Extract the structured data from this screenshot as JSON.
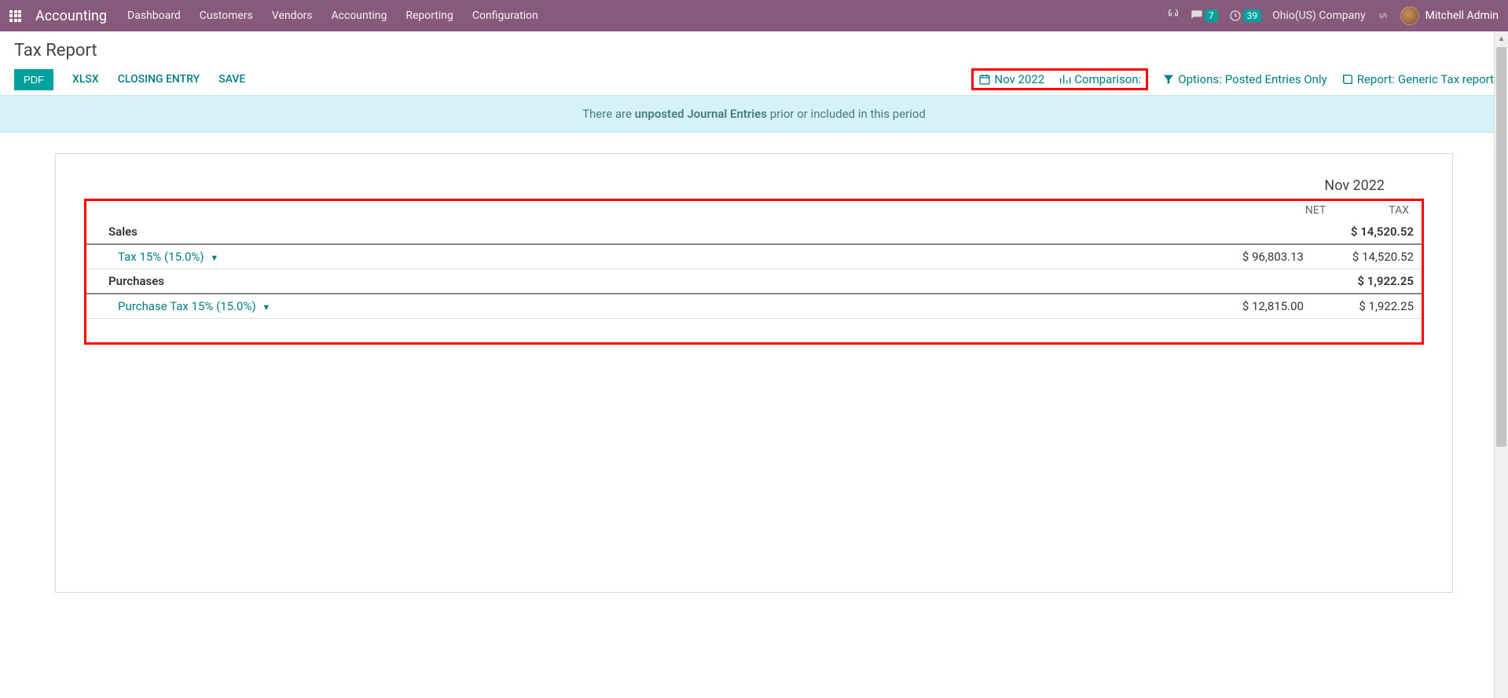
{
  "navbar": {
    "brand": "Accounting",
    "menu": [
      "Dashboard",
      "Customers",
      "Vendors",
      "Accounting",
      "Reporting",
      "Configuration"
    ],
    "messages_badge": "7",
    "activities_badge": "39",
    "company": "Ohio(US) Company",
    "user": "Mitchell Admin"
  },
  "page": {
    "title": "Tax Report",
    "actions": {
      "pdf": "PDF",
      "xlsx": "XLSX",
      "closing_entry": "CLOSING ENTRY",
      "save": "SAVE"
    },
    "filters": {
      "date_label": "Nov 2022",
      "comparison_label": "Comparison:",
      "options_prefix": "Options:",
      "options_value": "Posted Entries Only",
      "report_prefix": "Report: ",
      "report_value": "Generic Tax report"
    }
  },
  "banner": {
    "prefix": "There are ",
    "bold": "unposted Journal Entries",
    "suffix": " prior or included in this period"
  },
  "report": {
    "period": "Nov 2022",
    "col_net": "NET",
    "col_tax": "TAX",
    "sections": [
      {
        "name": "Sales",
        "totals": {
          "net": "",
          "tax": "$ 14,520.52"
        },
        "rows": [
          {
            "label": "Tax 15% (15.0%)",
            "net": "$ 96,803.13",
            "tax": "$ 14,520.52"
          }
        ]
      },
      {
        "name": "Purchases",
        "totals": {
          "net": "",
          "tax": "$ 1,922.25"
        },
        "rows": [
          {
            "label": "Purchase Tax 15% (15.0%)",
            "net": "$ 12,815.00",
            "tax": "$ 1,922.25"
          }
        ]
      }
    ]
  }
}
